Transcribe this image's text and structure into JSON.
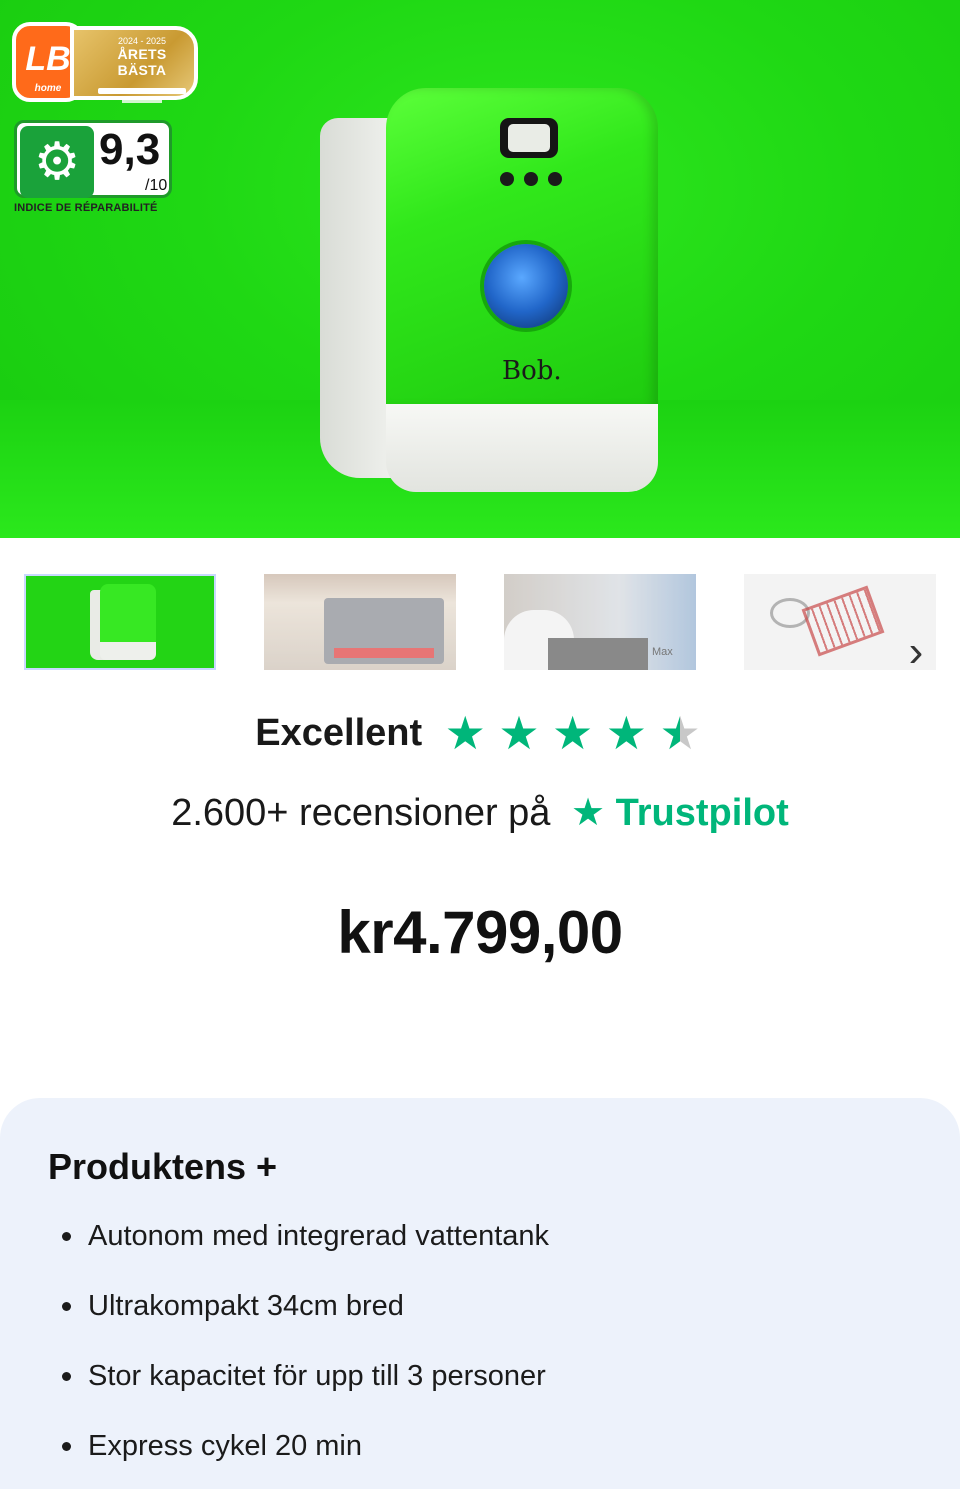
{
  "hero": {
    "award_badge": {
      "logo_text": "LB",
      "logo_sub": "home",
      "years": "2024 - 2025",
      "title": "ÅRETS BÄSTA"
    },
    "repair_badge": {
      "score": "9,3",
      "scale": "/10",
      "label": "INDICE DE RÉPARABILITÉ"
    },
    "product_logo": "Bob."
  },
  "thumbnails": {
    "max_label": "Max",
    "next_icon": "chevron-right-icon"
  },
  "rating": {
    "label": "Excellent",
    "stars": 4.5,
    "reviews_text": "2.600+ recensioner på",
    "brand": "Trustpilot",
    "brand_color": "#00b67a"
  },
  "price": "kr4.799,00",
  "benefits": {
    "title": "Produktens +",
    "items": [
      "Autonom med integrerad vattentank",
      "Ultrakompakt 34cm bred",
      "Stor kapacitet för upp till 3 personer",
      "Express cykel 20 min"
    ]
  }
}
